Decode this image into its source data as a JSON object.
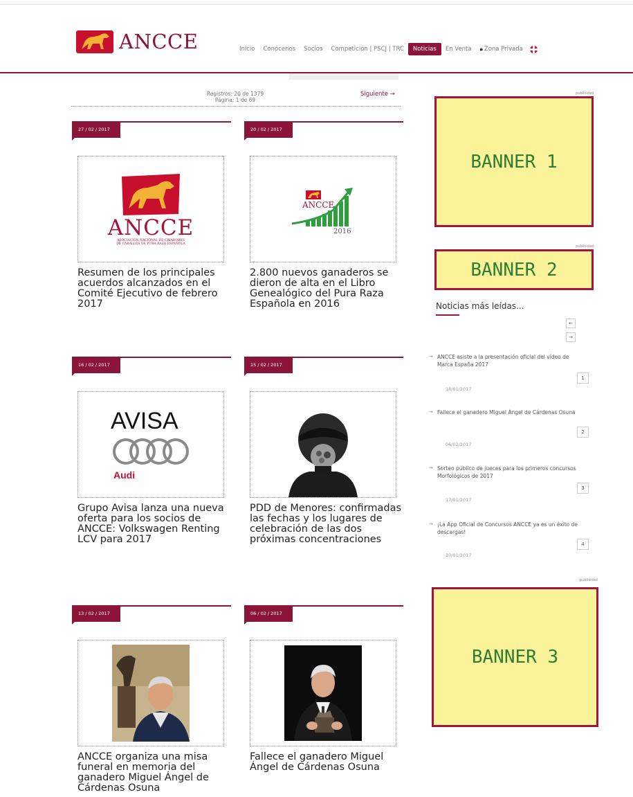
{
  "header": {
    "logo_text": "ANCCE",
    "nav": [
      {
        "label": "Inicio"
      },
      {
        "label": "Conócenos"
      },
      {
        "label": "Socios"
      },
      {
        "label": "Competición | PSCJ | TRC"
      },
      {
        "label": "Noticias",
        "active": true
      },
      {
        "label": "En Venta"
      },
      {
        "label": "Zona Privada"
      }
    ]
  },
  "pager": {
    "records": "Registros: 20 de 1379",
    "page": "Página: 1 de 69",
    "next_label": "Siguiente →"
  },
  "news": [
    {
      "date": "27 / 02 / 2017",
      "title": "Resumen de los principales acuerdos alcanzados en el Comité Ejecutivo de febrero 2017",
      "image": "ancce-logo",
      "logo_word": "ANCCE",
      "logo_sub1": "ASOCIACIÓN NACIONAL DE CRIADORES",
      "logo_sub2": "DE CABALLOS DE PURA RAZA ESPAÑOLA"
    },
    {
      "date": "20 / 02 / 2017",
      "title": "2.800 nuevos ganaderos se dieron de alta en el Libro Genealógico del Pura Raza Española en 2016",
      "image": "ancce-growth-chart",
      "logo_word": "ANCCE",
      "year": "2016"
    },
    {
      "date": "16 / 02 / 2017",
      "title": "Grupo Avisa lanza una nueva oferta para los socios de ANCCE: Volkswagen Renting LCV para 2017",
      "image": "avisa-audi-logo",
      "brand": "AVISA",
      "brand_sub": "Audi"
    },
    {
      "date": "15 / 02 / 2017",
      "title": "PDD de Menores: confirmadas las fechas y los lugares de celebración de las dos próximas concentraciones",
      "image": "rider-helmet-photo"
    },
    {
      "date": "13 / 02 / 2017",
      "title": "ANCCE organiza una misa funeral en memoria del ganadero Miguel Ángel de Cárdenas Osuna",
      "image": "man-with-statue-photo"
    },
    {
      "date": "06 / 02 / 2017",
      "title": "Fallece el ganadero Miguel Ángel de Cárdenas Osuna",
      "image": "man-with-award-photo"
    }
  ],
  "sidebar": {
    "ad_label": "publicidad",
    "banners": [
      "BANNER 1",
      "BANNER 2",
      "BANNER 3"
    ],
    "most_read_title": "Noticias más leídas...",
    "most_read": [
      {
        "title": "ANCCE asiste a la presentación oficial del vídeo de Marca España 2017",
        "date": "18/01/2017",
        "rank": "1"
      },
      {
        "title": "Fallece el ganadero Miguel Ángel de Cárdenas Osuna",
        "date": "06/02/2017",
        "rank": "2"
      },
      {
        "title": "Sorteo público de jueces para los primeros concursos Morfológicos de 2017",
        "date": "17/01/2017",
        "rank": "3"
      },
      {
        "title": "¡La App Oficial de Concursos ANCCE ya es un éxito de descargas!",
        "date": "30/01/2017",
        "rank": "4"
      }
    ]
  },
  "colors": {
    "brand": "#8a1538",
    "logo_gold": "#f2b233",
    "logo_red": "#c8102e",
    "banner_fill": "#fbf39a",
    "banner_text": "#2e7d32"
  }
}
